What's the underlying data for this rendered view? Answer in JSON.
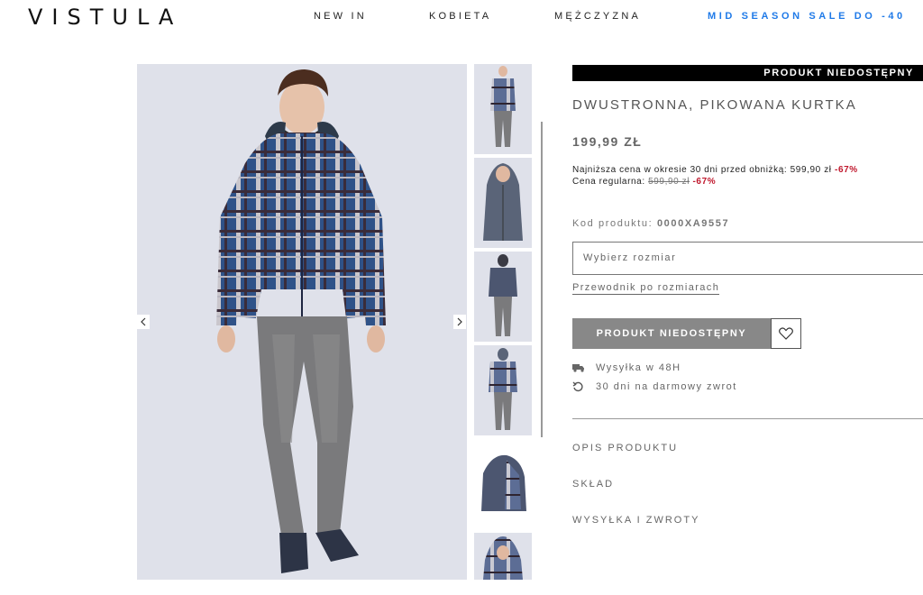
{
  "header": {
    "logo": "VISTULA",
    "nav": {
      "new_in": "NEW IN",
      "women": "KOBIETA",
      "men": "MĘŻCZYZNA",
      "sale": "MID SEASON SALE DO -40"
    },
    "sale_color": "#1f7ae8"
  },
  "gallery": {
    "main_icon": "product-photo-icon",
    "prev_icon": "chevron-left-icon",
    "next_icon": "chevron-right-icon",
    "thumbnail_count": 6
  },
  "product": {
    "availability_banner": "PRODUKT NIEDOSTĘPNY",
    "title": "DWUSTRONNA, PIKOWANA KURTKA",
    "price": "199,99 ZŁ",
    "lowest_price_label": "Najniższa cena w okresie 30 dni przed obniżką: 599,90 zł",
    "lowest_price_discount": "-67%",
    "regular_price_label": "Cena regularna:",
    "regular_price_value": "599,90 zł",
    "regular_price_discount": "-67%",
    "code_label": "Kod produktu:",
    "code_value": "0000XA9557",
    "size_placeholder": "Wybierz rozmiar",
    "size_guide": "Przewodnik po rozmiarach",
    "unavailable_button": "PRODUKT NIEDOSTĘPNY",
    "shipping": "Wysyłka w 48H",
    "returns": "30 dni na darmowy zwrot",
    "accordion": {
      "description": "OPIS PRODUKTU",
      "composition": "SKŁAD",
      "shipping_returns": "WYSYŁKA I ZWROTY"
    },
    "discount_color": "#c0182d"
  }
}
